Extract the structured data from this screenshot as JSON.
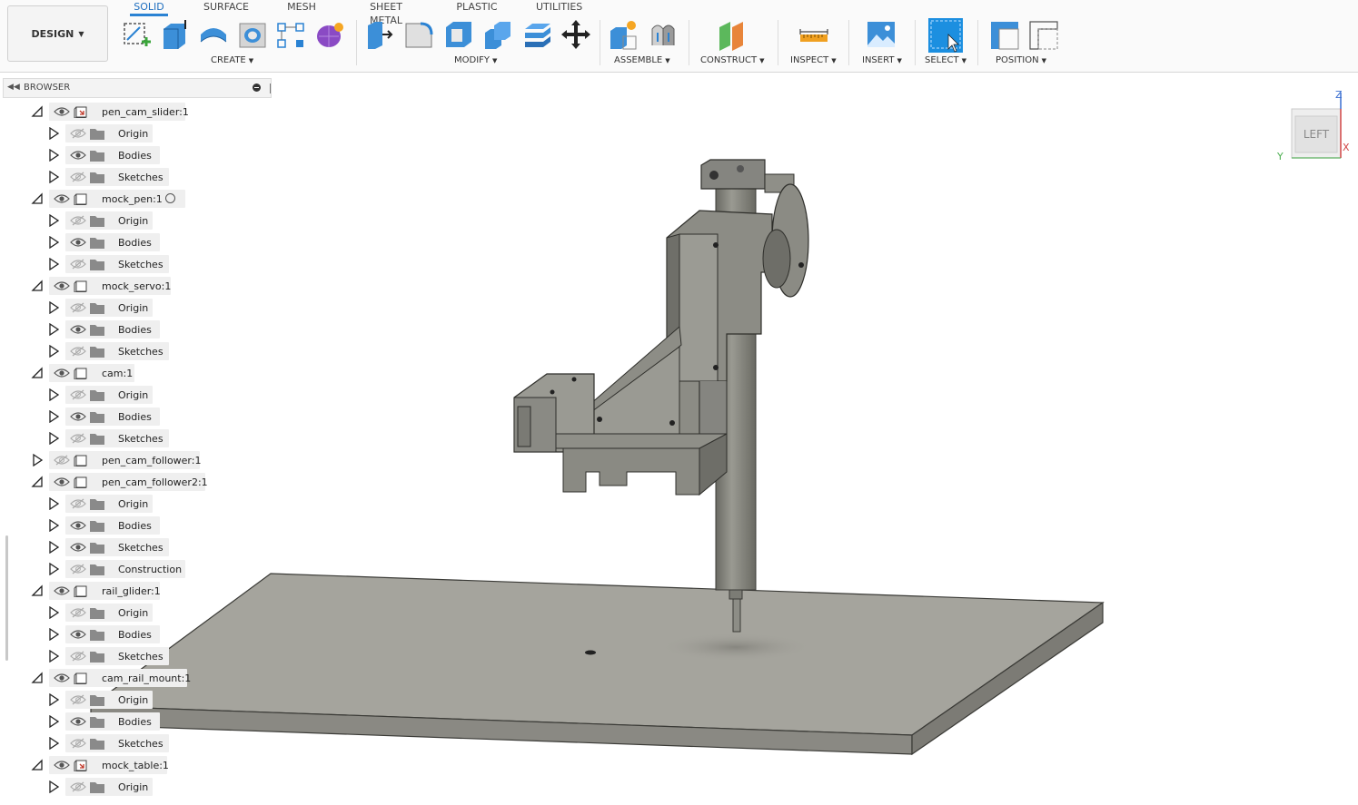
{
  "workspace": {
    "label": "DESIGN"
  },
  "tabs": [
    "SOLID",
    "SURFACE",
    "MESH",
    "SHEET METAL",
    "PLASTIC",
    "UTILITIES"
  ],
  "active_tab": "SOLID",
  "groups": {
    "create": "CREATE",
    "modify": "MODIFY",
    "assemble": "ASSEMBLE",
    "construct": "CONSTRUCT",
    "inspect": "INSPECT",
    "insert": "INSERT",
    "select": "SELECT",
    "position": "POSITION"
  },
  "browser": {
    "title": "BROWSER",
    "components": [
      {
        "label": "pen_cam_slider:1",
        "expanded": true,
        "visible": true,
        "linked": true,
        "children": [
          {
            "label": "Origin",
            "visible": false
          },
          {
            "label": "Bodies",
            "visible": true
          },
          {
            "label": "Sketches",
            "visible": false
          }
        ]
      },
      {
        "label": "mock_pen:1",
        "expanded": true,
        "visible": true,
        "linked": false,
        "radio": true,
        "children": [
          {
            "label": "Origin",
            "visible": false
          },
          {
            "label": "Bodies",
            "visible": true
          },
          {
            "label": "Sketches",
            "visible": false
          }
        ]
      },
      {
        "label": "mock_servo:1",
        "expanded": true,
        "visible": true,
        "linked": false,
        "children": [
          {
            "label": "Origin",
            "visible": false
          },
          {
            "label": "Bodies",
            "visible": true
          },
          {
            "label": "Sketches",
            "visible": false
          }
        ]
      },
      {
        "label": "cam:1",
        "expanded": true,
        "visible": true,
        "linked": false,
        "children": [
          {
            "label": "Origin",
            "visible": false
          },
          {
            "label": "Bodies",
            "visible": true
          },
          {
            "label": "Sketches",
            "visible": false
          }
        ]
      },
      {
        "label": "pen_cam_follower:1",
        "expanded": false,
        "visible": false,
        "linked": false,
        "children": []
      },
      {
        "label": "pen_cam_follower2:1",
        "expanded": true,
        "visible": true,
        "linked": false,
        "children": [
          {
            "label": "Origin",
            "visible": false
          },
          {
            "label": "Bodies",
            "visible": true
          },
          {
            "label": "Sketches",
            "visible": true
          },
          {
            "label": "Construction",
            "visible": false
          }
        ]
      },
      {
        "label": "rail_glider:1",
        "expanded": true,
        "visible": true,
        "linked": false,
        "children": [
          {
            "label": "Origin",
            "visible": false
          },
          {
            "label": "Bodies",
            "visible": true
          },
          {
            "label": "Sketches",
            "visible": false
          }
        ]
      },
      {
        "label": "cam_rail_mount:1",
        "expanded": true,
        "visible": true,
        "linked": false,
        "children": [
          {
            "label": "Origin",
            "visible": false
          },
          {
            "label": "Bodies",
            "visible": true
          },
          {
            "label": "Sketches",
            "visible": false
          }
        ]
      },
      {
        "label": "mock_table:1",
        "expanded": true,
        "visible": true,
        "linked": true,
        "children": [
          {
            "label": "Origin",
            "visible": false
          }
        ]
      }
    ]
  },
  "viewcube": {
    "face": "LEFT",
    "axes": {
      "z": "Z",
      "x": "X",
      "y": "Y"
    }
  },
  "colors": {
    "accent": "#2a82d3",
    "model": "#8f8f88",
    "model_dark": "#5e5e58",
    "plate": "#a5a49d"
  }
}
